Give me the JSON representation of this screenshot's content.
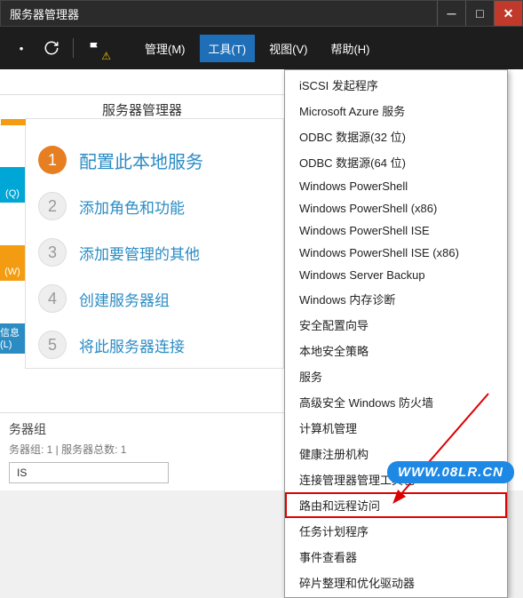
{
  "window": {
    "title": "服务器管理器"
  },
  "menubar": {
    "manage": "管理(M)",
    "tools": "工具(T)",
    "view": "视图(V)",
    "help": "帮助(H)"
  },
  "sub_header": "服务器管理器",
  "left_tags": {
    "q": "(Q)",
    "w": "(W)",
    "l": "信息(L)"
  },
  "steps": [
    {
      "label": "配置此本地服务"
    },
    {
      "label": "添加角色和功能"
    },
    {
      "label": "添加要管理的其他"
    },
    {
      "label": "创建服务器组"
    },
    {
      "label": "将此服务器连接"
    }
  ],
  "group": {
    "title": "务器组",
    "sub": "务器组: 1 | 服务器总数: 1",
    "box": "IS"
  },
  "tools_menu": [
    "iSCSI 发起程序",
    "Microsoft Azure 服务",
    "ODBC 数据源(32 位)",
    "ODBC 数据源(64 位)",
    "Windows PowerShell",
    "Windows PowerShell (x86)",
    "Windows PowerShell ISE",
    "Windows PowerShell ISE (x86)",
    "Windows Server Backup",
    "Windows 内存诊断",
    "安全配置向导",
    "本地安全策略",
    "服务",
    "高级安全 Windows 防火墙",
    "计算机管理",
    "健康注册机构",
    "连接管理器管理工具包",
    "路由和远程访问",
    "任务计划程序",
    "事件查看器",
    "碎片整理和优化驱动器"
  ],
  "highlighted_tool_index": 17,
  "watermark": "WWW.08LR.CN"
}
